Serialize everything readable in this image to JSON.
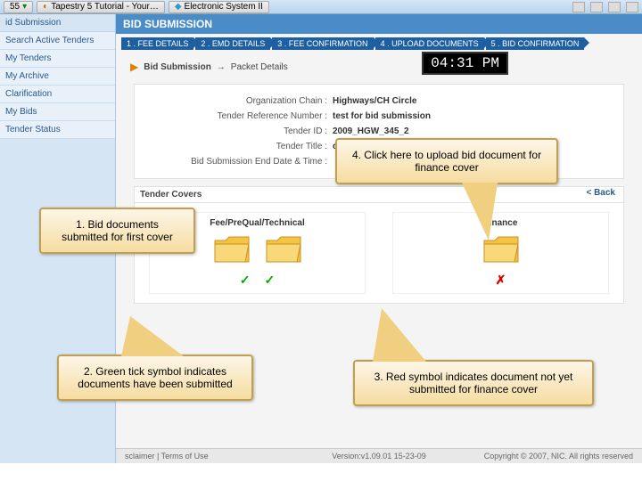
{
  "taskbar": {
    "btn1": "55",
    "tab1": "Tapestry 5 Tutorial - Your…",
    "tab2": "Electronic System II"
  },
  "sidebar": {
    "head": "id Submission",
    "items": [
      "Search Active Tenders",
      "My Tenders",
      "My Archive",
      "Clarification",
      "My Bids",
      "Tender Status"
    ]
  },
  "header": "BID SUBMISSION",
  "steps": [
    "1 . FEE DETAILS",
    "2 . EMD DETAILS",
    "3 . FEE CONFIRMATION",
    "4 . UPLOAD DOCUMENTS",
    "5 . BID CONFIRMATION"
  ],
  "breadcrumb": {
    "a": "Bid Submission",
    "sep": "→",
    "b": "Packet Details"
  },
  "timer": "04:31 PM",
  "details": {
    "org_l": "Organization Chain :",
    "org_v": "Highways/CH Circle",
    "ref_l": "Tender Reference Number :",
    "ref_v": "test for bid submission",
    "tid_l": "Tender ID :",
    "tid_v": "2009_HGW_345_2",
    "title_l": "Tender Title :",
    "title_v": "construction",
    "end_l": "Bid Submission End Date & Time :",
    "end_v": ""
  },
  "back": "< Back",
  "covers": {
    "head": "Tender Covers",
    "col1": "Fee/PreQual/Technical",
    "col2": "Finance"
  },
  "callouts": {
    "c1": "1. Bid documents submitted for first cover",
    "c2": "2. Green tick symbol indicates documents have been submitted",
    "c3": "3. Red symbol indicates document  not yet  submitted for finance cover",
    "c4": "4. Click here to upload bid document for finance cover"
  },
  "footer": {
    "left": "sclaimer  |  Terms of Use",
    "mid": "Version:v1.09.01 15-23-09",
    "right": "Copyright © 2007, NIC. All rights reserved"
  }
}
